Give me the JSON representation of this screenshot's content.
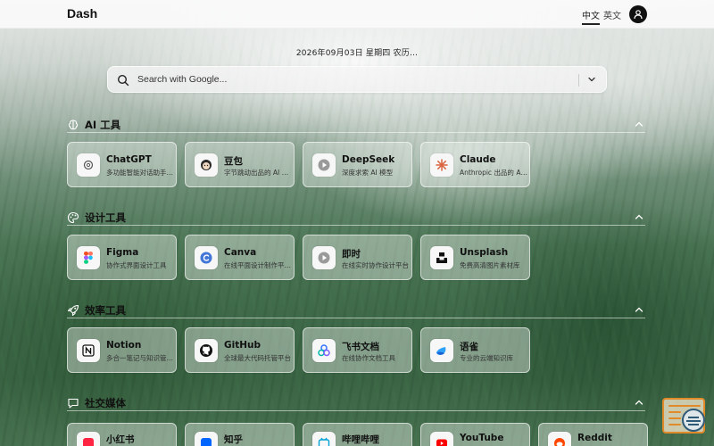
{
  "header": {
    "brand": "Dash",
    "lang_active": "中文",
    "lang_other": "英文"
  },
  "date_text": "2026年09月03日 星期四   农历…",
  "search": {
    "placeholder": "Search with Google...",
    "engine_icon": "chevron-down-icon"
  },
  "sections": [
    {
      "title": "AI 工具",
      "icon": "brain-icon",
      "cards": [
        {
          "name": "ChatGPT",
          "desc": "多功能智能对话助手工具",
          "icon": "openai-icon"
        },
        {
          "name": "豆包",
          "desc": "字节跳动出品的 AI 助手",
          "icon": "doubao-icon"
        },
        {
          "name": "DeepSeek",
          "desc": "深度求索 AI 模型",
          "icon": "deepseek-icon"
        },
        {
          "name": "Claude",
          "desc": "Anthropic 出品的 AI 助手",
          "icon": "claude-icon"
        }
      ]
    },
    {
      "title": "设计工具",
      "icon": "palette-icon",
      "cards": [
        {
          "name": "Figma",
          "desc": "协作式界面设计工具",
          "icon": "figma-icon"
        },
        {
          "name": "Canva",
          "desc": "在线平面设计制作平台工具",
          "icon": "canva-icon"
        },
        {
          "name": "即时",
          "desc": "在线实时协作设计平台",
          "icon": "play-icon"
        },
        {
          "name": "Unsplash",
          "desc": "免费高清图片素材库",
          "icon": "unsplash-icon"
        }
      ]
    },
    {
      "title": "效率工具",
      "icon": "rocket-icon",
      "cards": [
        {
          "name": "Notion",
          "desc": "多合一笔记与知识管理工具",
          "icon": "notion-icon"
        },
        {
          "name": "GitHub",
          "desc": "全球最大代码托管平台",
          "icon": "github-icon"
        },
        {
          "name": "飞书文档",
          "desc": "在线协作文档工具",
          "icon": "feishu-icon"
        },
        {
          "name": "语雀",
          "desc": "专业的云端知识库",
          "icon": "yuque-icon"
        }
      ]
    },
    {
      "title": "社交媒体",
      "icon": "chat-icon",
      "cards": [
        {
          "name": "小红书",
          "desc": "",
          "icon": "xiaohongshu-icon"
        },
        {
          "name": "知乎",
          "desc": "",
          "icon": "zhihu-icon"
        },
        {
          "name": "哔哩哔哩",
          "desc": "",
          "icon": "bilibili-icon"
        },
        {
          "name": "YouTube",
          "desc": "",
          "icon": "youtube-icon"
        },
        {
          "name": "Reddit",
          "desc": "",
          "icon": "reddit-icon"
        }
      ]
    }
  ],
  "colors": {
    "accent_orange": "#e08a2a",
    "widget_blue": "#2e5a78"
  }
}
